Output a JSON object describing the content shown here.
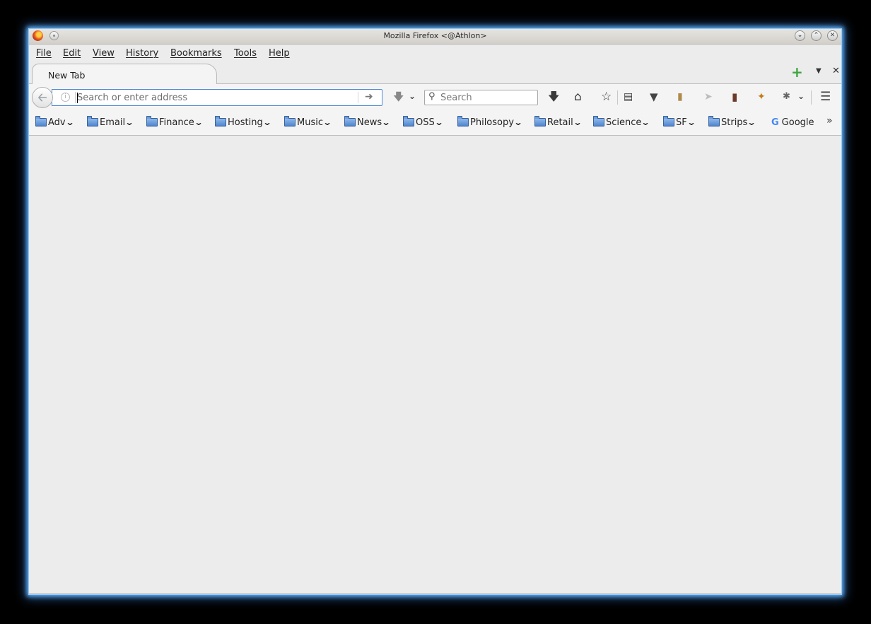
{
  "window": {
    "title": "Mozilla Firefox <@Athlon>"
  },
  "menubar": {
    "items": [
      {
        "label": "File"
      },
      {
        "label": "Edit"
      },
      {
        "label": "View"
      },
      {
        "label": "History"
      },
      {
        "label": "Bookmarks"
      },
      {
        "label": "Tools"
      },
      {
        "label": "Help"
      }
    ]
  },
  "tabs": [
    {
      "label": "New Tab"
    }
  ],
  "navbar": {
    "url_placeholder": "Search or enter address",
    "search_placeholder": "Search"
  },
  "bookmarks": {
    "items": [
      {
        "label": "Adv",
        "type": "folder"
      },
      {
        "label": "Email",
        "type": "folder"
      },
      {
        "label": "Finance",
        "type": "folder"
      },
      {
        "label": "Hosting",
        "type": "folder"
      },
      {
        "label": "Music",
        "type": "folder"
      },
      {
        "label": "News",
        "type": "folder"
      },
      {
        "label": "OSS",
        "type": "folder"
      },
      {
        "label": "Philosopy",
        "type": "folder"
      },
      {
        "label": "Retail",
        "type": "folder"
      },
      {
        "label": "Science",
        "type": "folder"
      },
      {
        "label": "SF",
        "type": "folder"
      },
      {
        "label": "Strips",
        "type": "folder"
      },
      {
        "label": "Google",
        "type": "link"
      }
    ]
  },
  "colors": {
    "accent_glow": "#5fb6ff",
    "urlbar_focus": "#4d89d6",
    "new_tab_plus": "#3ea63e"
  }
}
